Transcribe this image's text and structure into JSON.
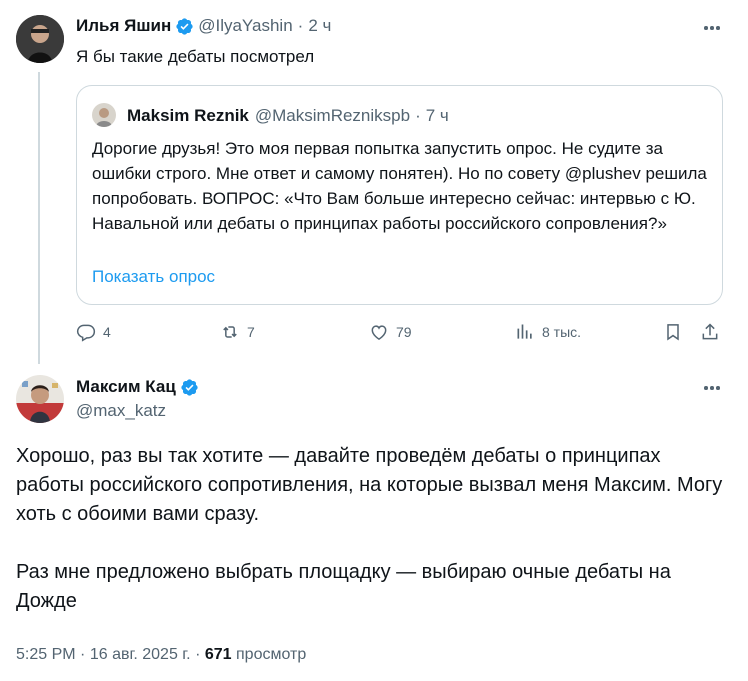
{
  "parent_tweet": {
    "author_name": "Илья Яшин",
    "handle": "@IlyaYashin",
    "time": "2 ч",
    "text": "Я бы такие дебаты посмотрел",
    "quote": {
      "author_name": "Maksim Reznik",
      "handle": "@MaksimReznikspb",
      "time": "7 ч",
      "text": "Дорогие друзья! Это моя первая попытка запустить опрос. Не судите за ошибки строго. Мне ответ и самому понятен). Но по совету @plushev решила попробовать. ВОПРОС: «Что Вам больше интересно сейчас: интервью с Ю. Навальной или дебаты о принципах работы российского сопровления?»",
      "poll_link": "Показать опрос"
    },
    "stats": {
      "replies": "4",
      "reposts": "7",
      "likes": "79",
      "views": "8 тыс."
    }
  },
  "main_tweet": {
    "author_name": "Максим Кац",
    "handle": "@max_katz",
    "paragraph_1": "Хорошо, раз вы так хотите — давайте проведём дебаты о принципах работы российского сопротивления, на которые вызвал меня Максим. Могу хоть с обоими вами сразу.",
    "paragraph_2": "Раз мне предложено выбрать площадку — выбираю очные дебаты на Дожде",
    "time": "5:25 PM",
    "date": "16 авг. 2025 г.",
    "views_count": "671",
    "views_label": "просмотр"
  },
  "colors": {
    "accent": "#1d9bf0",
    "text": "#0f1419",
    "muted": "#536471",
    "border": "#cfd9de"
  },
  "icons": [
    "verified-badge-icon",
    "more-icon",
    "reply-icon",
    "repost-icon",
    "like-icon",
    "views-icon",
    "bookmark-icon",
    "share-icon"
  ]
}
